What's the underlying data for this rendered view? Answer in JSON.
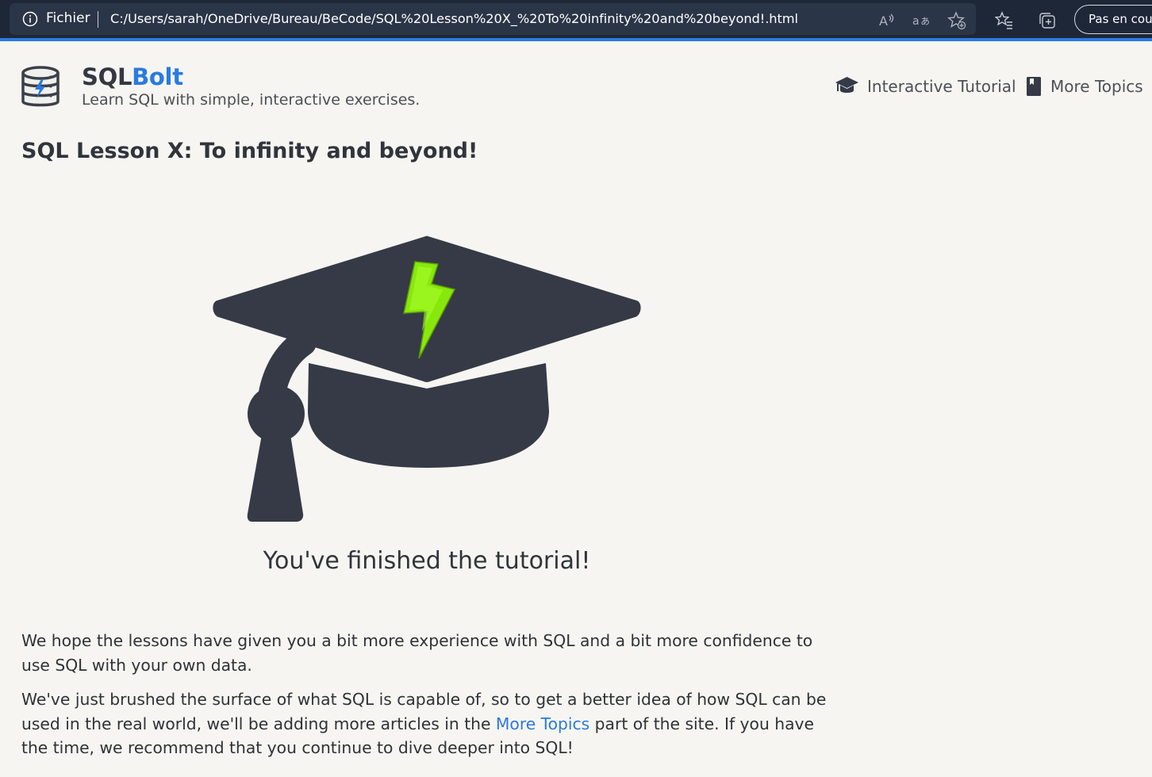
{
  "browser": {
    "info_label": "Fichier",
    "url": "C:/Users/sarah/OneDrive/Bureau/BeCode/SQL%20Lesson%20X_%20To%20infinity%20and%20beyond!.html",
    "profile_button": "Pas en cours",
    "icons": [
      "info-icon",
      "read-aloud-icon",
      "translate-icon",
      "add-favorite-icon",
      "favorites-icon",
      "collections-icon"
    ]
  },
  "header": {
    "brand_prefix": "SQL",
    "brand_accent": "Bolt",
    "tagline": "Learn SQL with simple, interactive exercises.",
    "nav": [
      {
        "label": "Interactive Tutorial",
        "icon": "graduation-cap-icon"
      },
      {
        "label": "More Topics",
        "icon": "book-icon"
      }
    ]
  },
  "main": {
    "title": "SQL Lesson X: To infinity and beyond!",
    "finish_caption": "You've finished the tutorial!",
    "paragraph1": "We hope the lessons have given you a bit more experience with SQL and a bit more confidence to use SQL with your own data.",
    "paragraph2_before": "We've just brushed the surface of what SQL is capable of, so to get a better idea of how SQL can be used in the real world, we'll be adding more articles in the ",
    "paragraph2_link": "More Topics",
    "paragraph2_after": " part of the site. If you have the time, we recommend that you continue to dive deeper into SQL!"
  },
  "colors": {
    "accent": "#2a7ae0",
    "background": "#f6f5f1",
    "text": "#30343c",
    "hat": "#353a46",
    "bolt": "#88e80c",
    "browser_bar": "#1d2738"
  }
}
